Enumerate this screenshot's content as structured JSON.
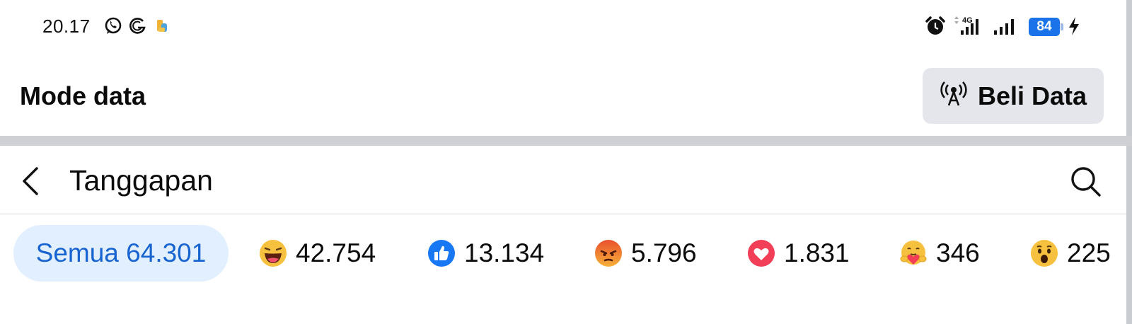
{
  "status_bar": {
    "time": "20.17",
    "battery": "84",
    "icons": [
      "whatsapp-icon",
      "g-icon",
      "app-icon",
      "alarm-icon",
      "signal-4g-icon",
      "signal-icon",
      "battery-icon",
      "charging-icon"
    ]
  },
  "data_mode": {
    "title": "Mode data",
    "buy_label": "Beli Data",
    "buy_icon": "broadcast-icon"
  },
  "header": {
    "title": "Tanggapan",
    "back_icon": "chevron-left-icon",
    "search_icon": "search-icon"
  },
  "tabs": [
    {
      "label": "Semua",
      "count": "64.301",
      "selected": true
    },
    {
      "reaction": "haha",
      "count": "42.754"
    },
    {
      "reaction": "like",
      "count": "13.134"
    },
    {
      "reaction": "angry",
      "count": "5.796"
    },
    {
      "reaction": "love",
      "count": "1.831"
    },
    {
      "reaction": "care",
      "count": "346"
    },
    {
      "reaction": "wow",
      "count": "225"
    }
  ],
  "colors": {
    "accent": "#1763cf",
    "selected_tab_bg": "#e2efff",
    "button_bg": "#e4e6eb",
    "divider": "#ced0d4",
    "battery": "#1a73e8"
  }
}
